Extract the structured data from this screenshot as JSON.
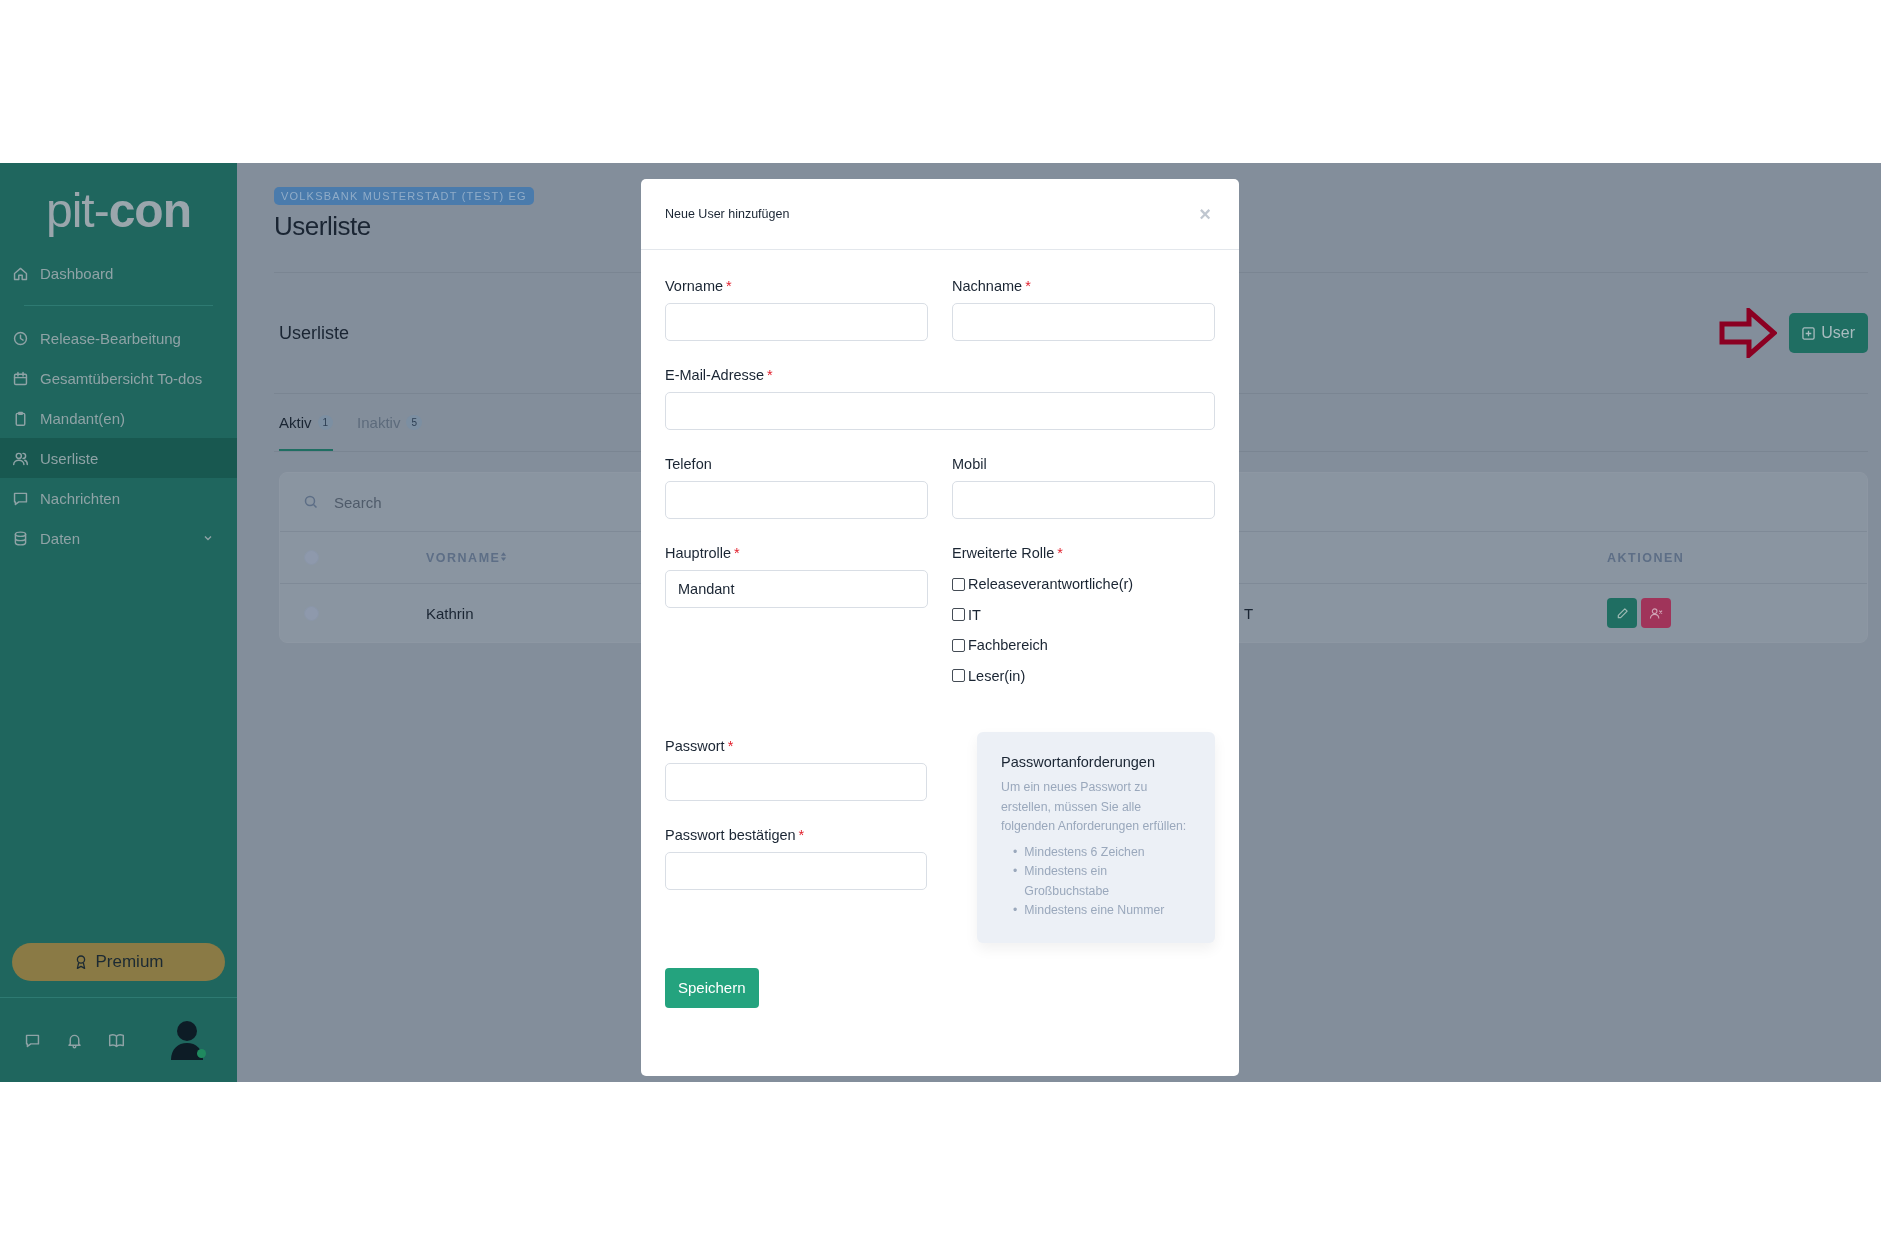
{
  "sidebar": {
    "logo": {
      "light": "pit-",
      "bold": "con"
    },
    "sections": [
      [
        {
          "label": "Dashboard",
          "selected": false,
          "kind": "link"
        }
      ],
      [
        {
          "label": "Release-Bearbeitung",
          "selected": false,
          "kind": "link"
        },
        {
          "label": "Gesamtübersicht To-dos",
          "selected": false,
          "kind": "link"
        },
        {
          "label": "Mandant(en)",
          "selected": false,
          "kind": "link"
        },
        {
          "label": "Userliste",
          "selected": true,
          "kind": "link"
        },
        {
          "label": "Nachrichten",
          "selected": false,
          "kind": "link"
        },
        {
          "label": "Daten",
          "selected": false,
          "kind": "group",
          "expanded": false
        }
      ]
    ],
    "premium_button": "Premium",
    "user": {
      "online": true
    }
  },
  "main": {
    "org_badge": "VOLKSBANK MUSTERSTADT (TEST) EG",
    "title": "Userliste",
    "card": {
      "title": "Userliste",
      "add_button": "User",
      "tabs": [
        {
          "label": "Aktiv",
          "count": "1",
          "selected": true
        },
        {
          "label": "Inaktiv",
          "count": "5",
          "selected": false
        }
      ],
      "search": {
        "placeholder": "Search"
      },
      "table": {
        "all_selected": false,
        "columns": [
          {
            "kind": "text",
            "label": "VORNAME",
            "sortable": true
          },
          {
            "kind": "text"
          },
          {
            "kind": "actions",
            "label": "AKTIONEN"
          }
        ],
        "rows": [
          {
            "selected": false,
            "cells": [
              "Kathrin",
              "T"
            ]
          }
        ]
      }
    }
  },
  "modal": {
    "title": "Neue User hinzufügen",
    "close": "×",
    "rows": [
      [
        {
          "kind": "input",
          "label": "Vorname",
          "required_mark": "*"
        },
        {
          "kind": "input",
          "label": "Nachname",
          "required_mark": "*"
        }
      ],
      [
        {
          "kind": "input",
          "label": "E-Mail-Adresse",
          "required_mark": "*"
        }
      ],
      [
        {
          "kind": "input",
          "label": "Telefon"
        },
        {
          "kind": "input",
          "label": "Mobil"
        }
      ],
      [
        {
          "kind": "input",
          "label": "Hauptrolle",
          "required_mark": "*",
          "value": "Mandant"
        },
        {
          "kind": "checkboxes",
          "label": "Erweiterte Rolle",
          "required_mark": "*",
          "options": [
            {
              "label": "Releaseverantwortliche(r)",
              "checked": false
            },
            {
              "label": "IT",
              "checked": false
            },
            {
              "label": "Fachbereich",
              "checked": false
            },
            {
              "label": "Leser(in)",
              "checked": false
            }
          ]
        }
      ]
    ],
    "password_fields": [
      {
        "kind": "input",
        "label": "Passwort",
        "required_mark": "*"
      },
      {
        "kind": "input",
        "label": "Passwort bestätigen",
        "required_mark": "*"
      }
    ],
    "requirements": {
      "title": "Passwortanforderungen",
      "intro": "Um ein neues Passwort zu erstellen, müssen Sie alle folgenden Anforderungen erfüllen:",
      "bullet": "•",
      "items": [
        "Mindestens 6 Zeichen",
        "Mindestens ein Großbuchstabe",
        "Mindestens eine Nummer"
      ]
    },
    "save_button": "Speichern"
  }
}
